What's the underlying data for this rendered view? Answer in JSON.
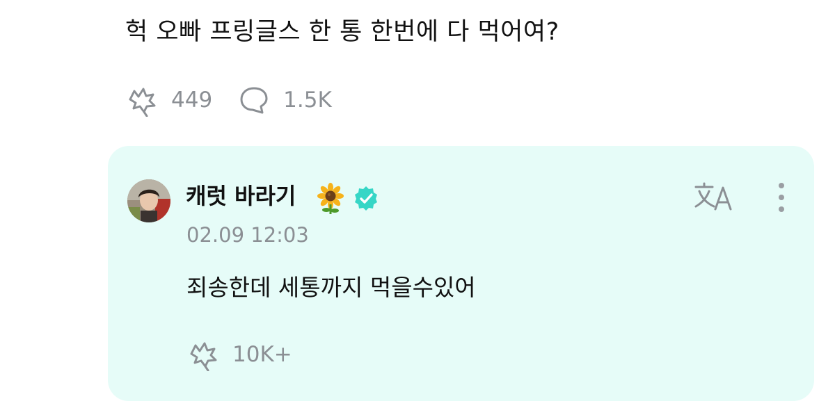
{
  "post": {
    "text": "헉 오빠 프링글스 한 통 한번에 다 먹어여?",
    "like_count": "449",
    "comment_count": "1.5K"
  },
  "reply": {
    "author_name": "캐럿 바라기",
    "timestamp": "02.09 12:03",
    "text": "죄송한데 세통까지 먹을수있어",
    "like_count": "10K+",
    "background_color": "#e6fcf8",
    "verified_color": "#36d6c6"
  },
  "icons": {
    "like": "like-icon",
    "comment": "comment-icon",
    "translate": "translate-icon",
    "more": "more-vertical-icon",
    "verified": "verified-badge-icon",
    "sunflower": "sunflower-emoji-icon"
  }
}
